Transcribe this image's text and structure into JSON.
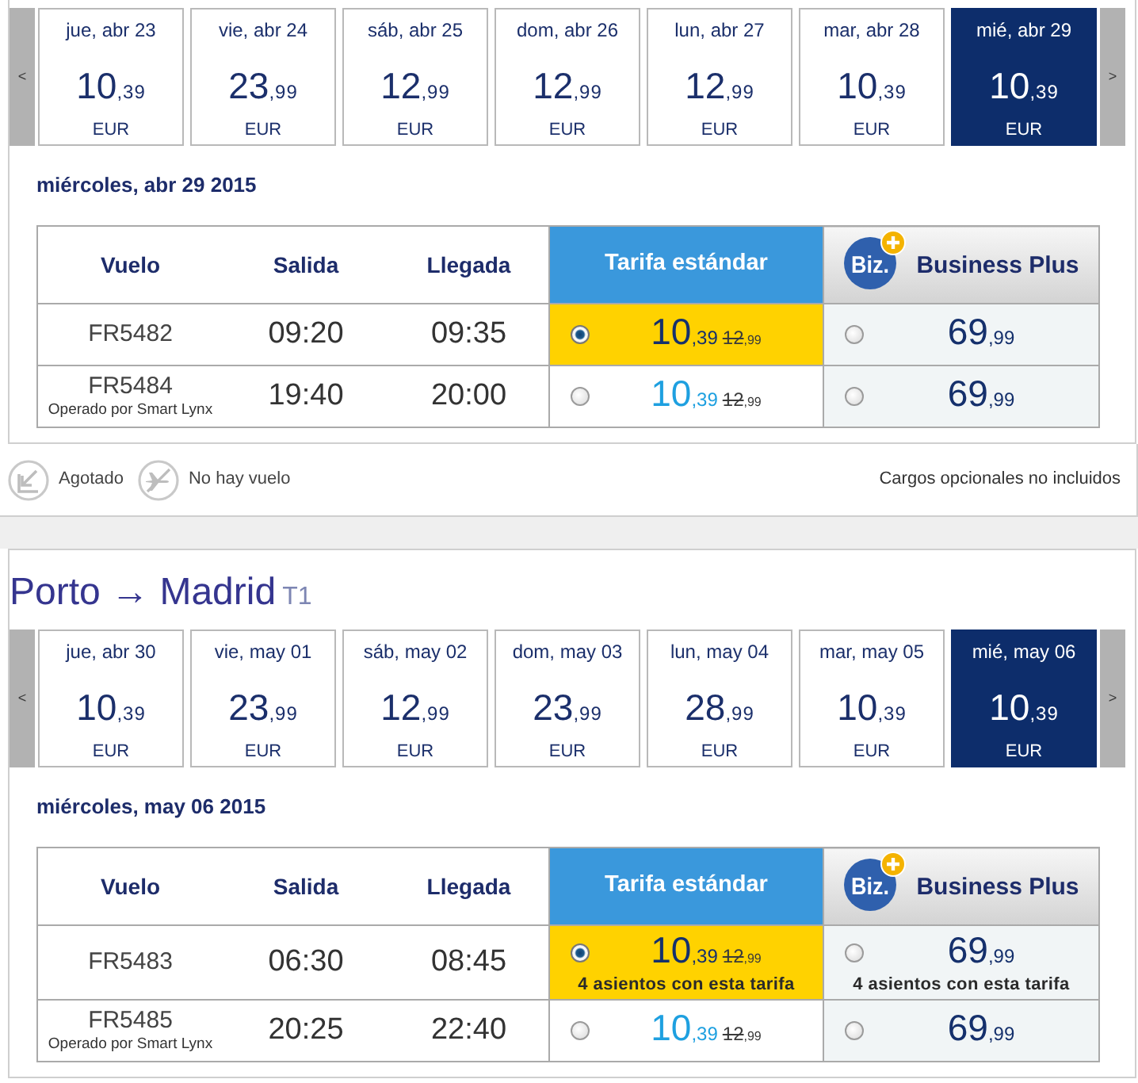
{
  "journeys": [
    {
      "prev": "<",
      "next": ">",
      "dates": [
        {
          "label": "jue, abr 23",
          "units": "10",
          "cents": ",39",
          "currency": "EUR",
          "selected": false
        },
        {
          "label": "vie, abr 24",
          "units": "23",
          "cents": ",99",
          "currency": "EUR",
          "selected": false
        },
        {
          "label": "sáb, abr 25",
          "units": "12",
          "cents": ",99",
          "currency": "EUR",
          "selected": false
        },
        {
          "label": "dom, abr 26",
          "units": "12",
          "cents": ",99",
          "currency": "EUR",
          "selected": false
        },
        {
          "label": "lun, abr 27",
          "units": "12",
          "cents": ",99",
          "currency": "EUR",
          "selected": false
        },
        {
          "label": "mar, abr 28",
          "units": "10",
          "cents": ",39",
          "currency": "EUR",
          "selected": false
        },
        {
          "label": "mié, abr 29",
          "units": "10",
          "cents": ",39",
          "currency": "EUR",
          "selected": true
        }
      ],
      "day": "miércoles, abr 29 2015",
      "columns": [
        {
          "kind": "plain",
          "label": "Vuelo"
        },
        {
          "kind": "plain",
          "label": "Salida"
        },
        {
          "kind": "plain",
          "label": "Llegada"
        },
        {
          "kind": "standard",
          "label": "Tarifa estándar"
        },
        {
          "kind": "business",
          "label": "Business Plus",
          "logo_text": "Biz."
        }
      ],
      "flights": [
        {
          "number": "FR5482",
          "departure": "09:20",
          "arrival": "09:35",
          "fares": [
            {
              "kind": "standard",
              "units": "10",
              "cents": ",39",
              "old_units": "12",
              "old_cents": ",99",
              "selected": true
            },
            {
              "kind": "business",
              "units": "69",
              "cents": ",99",
              "selected": false
            }
          ]
        },
        {
          "number": "FR5484",
          "operator": "Operado por Smart Lynx",
          "departure": "19:40",
          "arrival": "20:00",
          "fares": [
            {
              "kind": "standard",
              "units": "10",
              "cents": ",39",
              "old_units": "12",
              "old_cents": ",99",
              "selected": false
            },
            {
              "kind": "business",
              "units": "69",
              "cents": ",99",
              "selected": false
            }
          ]
        }
      ],
      "legend": {
        "items": [
          {
            "kind": "sold_out",
            "label": "Agotado"
          },
          {
            "kind": "no_flight",
            "label": "No hay vuelo"
          }
        ],
        "note": "Cargos opcionales no incluidos"
      }
    },
    {
      "route": {
        "text": "Porto → Madrid",
        "terminal": "T1"
      },
      "prev": "<",
      "next": ">",
      "dates": [
        {
          "label": "jue, abr 30",
          "units": "10",
          "cents": ",39",
          "currency": "EUR",
          "selected": false
        },
        {
          "label": "vie, may 01",
          "units": "23",
          "cents": ",99",
          "currency": "EUR",
          "selected": false
        },
        {
          "label": "sáb, may 02",
          "units": "12",
          "cents": ",99",
          "currency": "EUR",
          "selected": false
        },
        {
          "label": "dom, may 03",
          "units": "23",
          "cents": ",99",
          "currency": "EUR",
          "selected": false
        },
        {
          "label": "lun, may 04",
          "units": "28",
          "cents": ",99",
          "currency": "EUR",
          "selected": false
        },
        {
          "label": "mar, may 05",
          "units": "10",
          "cents": ",39",
          "currency": "EUR",
          "selected": false
        },
        {
          "label": "mié, may 06",
          "units": "10",
          "cents": ",39",
          "currency": "EUR",
          "selected": true
        }
      ],
      "day": "miércoles, may 06 2015",
      "columns": [
        {
          "kind": "plain",
          "label": "Vuelo"
        },
        {
          "kind": "plain",
          "label": "Salida"
        },
        {
          "kind": "plain",
          "label": "Llegada"
        },
        {
          "kind": "standard",
          "label": "Tarifa estándar"
        },
        {
          "kind": "business",
          "label": "Business Plus",
          "logo_text": "Biz."
        }
      ],
      "flights": [
        {
          "number": "FR5483",
          "departure": "06:30",
          "arrival": "08:45",
          "fares": [
            {
              "kind": "standard",
              "units": "10",
              "cents": ",39",
              "old_units": "12",
              "old_cents": ",99",
              "selected": true,
              "seats": "4 asientos con esta tarifa"
            },
            {
              "kind": "business",
              "units": "69",
              "cents": ",99",
              "selected": false,
              "seats": "4 asientos con esta tarifa"
            }
          ]
        },
        {
          "number": "FR5485",
          "operator": "Operado por Smart Lynx",
          "departure": "20:25",
          "arrival": "22:40",
          "fares": [
            {
              "kind": "standard",
              "units": "10",
              "cents": ",39",
              "old_units": "12",
              "old_cents": ",99",
              "selected": false
            },
            {
              "kind": "business",
              "units": "69",
              "cents": ",99",
              "selected": false
            }
          ]
        }
      ]
    }
  ]
}
